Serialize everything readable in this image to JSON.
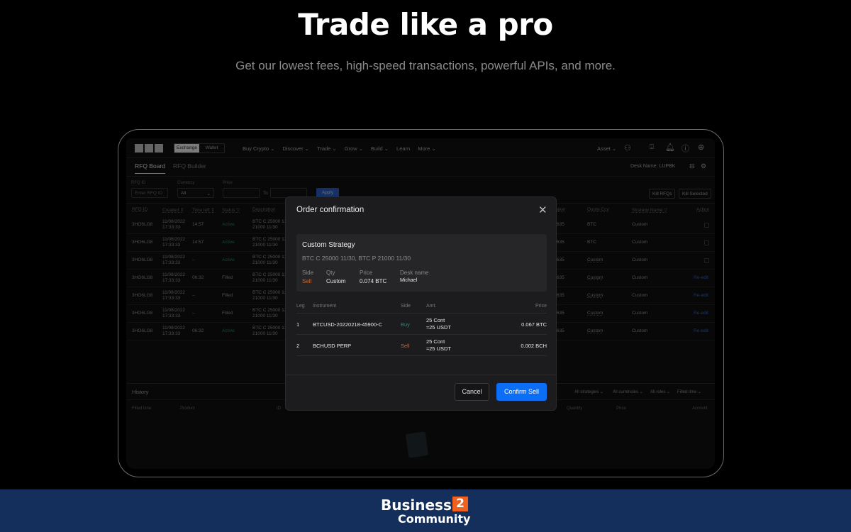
{
  "hero": {
    "title": "Trade like a pro",
    "subtitle": "Get our lowest fees, high-speed transactions, powerful APIs, and more."
  },
  "nav": {
    "logo": "OKX",
    "toggle": [
      "Exchange",
      "Wallet"
    ],
    "items": [
      "Buy Crypto ⌄",
      "Discover ⌄",
      "Trade ⌄",
      "Grow ⌄",
      "Build ⌄",
      "Learn",
      "More ⌄"
    ],
    "asset": "Asset ⌄",
    "icons": [
      "user-icon",
      "download-icon",
      "bell-icon",
      "help-icon",
      "globe-icon"
    ]
  },
  "tabs": {
    "items": [
      "RFQ Board",
      "RFQ Builder"
    ],
    "active": "RFQ Board",
    "desk": "Desk Name: LUPBK"
  },
  "filters": {
    "rfq_label": "RFQ ID",
    "rfq_placeholder": "Enter RFQ ID",
    "currency_label": "Currency",
    "currency_value": "All",
    "price_label": "Price",
    "to": "To",
    "apply": "Apply",
    "kill_rfqs": "Kill RFQs",
    "kill_selected": "Kill Selected"
  },
  "table": {
    "headers": [
      "RFQ ID",
      "Created ⇕",
      "Time left ⇕",
      "Status ▽",
      "Description",
      "aker",
      "Quote Ccy",
      "Strategy Name ▽",
      "Action"
    ],
    "rows": [
      {
        "id": "3HO6LG8",
        "date": "11/08/2022",
        "time": "17:33:33",
        "left": "14:57",
        "status": "Active",
        "desc1": "BTC C 25000 11/30",
        "desc2": "21000 11/30",
        "maker": "635",
        "quote": "BTC",
        "strategy": "Custom",
        "action": "checkbox"
      },
      {
        "id": "3HO6LG8",
        "date": "11/08/2022",
        "time": "17:33:33",
        "left": "14:57",
        "status": "Active",
        "desc1": "BTC C 25000 11/30",
        "desc2": "21000 11/30",
        "maker": "635",
        "quote": "BTC",
        "strategy": "Custom",
        "action": "checkbox"
      },
      {
        "id": "3HO6LG8",
        "date": "11/08/2022",
        "time": "17:33:33",
        "left": "--",
        "status": "Active",
        "desc1": "BTC C 25000 11/30",
        "desc2": "21000 11/30",
        "maker": "635",
        "quote": "Custom",
        "strategy": "Custom",
        "action": "checkbox"
      },
      {
        "id": "3HO6LG8",
        "date": "11/08/2022",
        "time": "17:33:33",
        "left": "06:32",
        "status": "Filled",
        "desc1": "BTC C 25000 11/30",
        "desc2": "21000 11/30",
        "maker": "635",
        "quote": "Custom",
        "strategy": "Custom",
        "action": "Re-edit"
      },
      {
        "id": "3HO6LG8",
        "date": "11/08/2022",
        "time": "17:33:33",
        "left": "--",
        "status": "Filled",
        "desc1": "BTC C 25000 11/30",
        "desc2": "21000 11/30",
        "maker": "635",
        "quote": "Custom",
        "strategy": "Custom",
        "action": "Re-edit"
      },
      {
        "id": "3HO6LG8",
        "date": "11/08/2022",
        "time": "17:33:33",
        "left": "--",
        "status": "Filled",
        "desc1": "BTC C 25000 11/30",
        "desc2": "21000 11/30",
        "maker": "635",
        "quote": "Custom",
        "strategy": "Custom",
        "action": "Re-edit"
      },
      {
        "id": "3HO6LG8",
        "date": "11/08/2022",
        "time": "17:33:33",
        "left": "06:32",
        "status": "Active",
        "desc1": "BTC C 25000 11/30",
        "desc2": "21000 11/30",
        "maker": "635",
        "quote": "Custom",
        "strategy": "Custom",
        "action": "Re-edit"
      }
    ]
  },
  "history": {
    "title": "History",
    "filters": [
      "All strategies ⌄",
      "All currencies ⌄",
      "All roles ⌄",
      "Filled time ⌄"
    ],
    "headers": [
      "Filled time",
      "Product",
      "ID",
      "Quantity",
      "Price",
      "Account"
    ]
  },
  "modal": {
    "title": "Order confirmation",
    "strategy": "Custom Strategy",
    "legs_desc": "BTC C 25000 11/30, BTC P 21000 11/30",
    "summary": [
      {
        "label": "Side",
        "value": "Sell"
      },
      {
        "label": "Qty",
        "value": "Custom"
      },
      {
        "label": "Price",
        "value": "0.074 BTC"
      },
      {
        "label": "Desk name",
        "value": "Michael"
      }
    ],
    "headers": [
      "Leg",
      "Instrument",
      "Side",
      "Amt.",
      "Price"
    ],
    "legs": [
      {
        "leg": "1",
        "instrument": "BTCUSD-20220218-45900-C",
        "side": "Buy",
        "amt": "25 Cont",
        "amt_sub": "≈25 USDT",
        "price": "0.067 BTC"
      },
      {
        "leg": "2",
        "instrument": "BCHUSD PERP",
        "side": "Sell",
        "amt": "25 Cont",
        "amt_sub": "≈25 USDT",
        "price": "0.002 BCH"
      }
    ],
    "cancel": "Cancel",
    "confirm": "Confirm Sell"
  },
  "footer": {
    "brand": "Business",
    "brand_num": "2",
    "brand2": "Community"
  },
  "colors": {
    "accent": "#0b6ef5",
    "sell": "#c06a3c",
    "buy": "#1d8c7a",
    "footer": "#142f5c"
  }
}
